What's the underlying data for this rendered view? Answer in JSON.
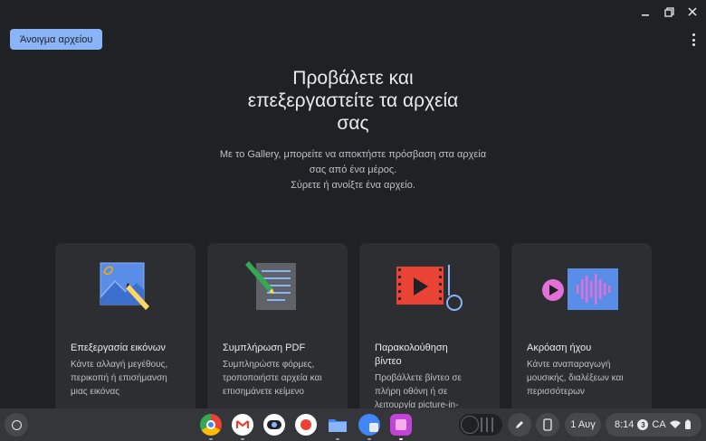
{
  "toolbar": {
    "open_label": "Άνοιγμα αρχείου"
  },
  "hero": {
    "title_line1": "Προβάλετε και",
    "title_line2": "επεξεργαστείτε τα αρχεία",
    "title_line3": "σας",
    "sub_line1": "Με το Gallery, μπορείτε να αποκτήστε πρόσβαση στα αρχεία",
    "sub_line2": "σας από ένα μέρος.",
    "sub_line3": "Σύρετε ή ανοίξτε ένα αρχείο."
  },
  "cards": [
    {
      "icon": "image-edit-icon",
      "title": "Επεξεργασία εικόνων",
      "desc_lines": [
        "Κάντε αλλαγή μεγέθους,",
        "περικοπή ή επισήμανση",
        "μιας εικόνας"
      ]
    },
    {
      "icon": "pdf-fill-icon",
      "title": "Συμπλήρωση PDF",
      "desc_lines": [
        "Συμπληρώστε φόρμες,",
        "τροποποιήστε αρχεία και",
        "επισημάνετε κείμενο"
      ]
    },
    {
      "icon": "video-play-icon",
      "title_lines": [
        "Παρακολούθηση",
        "βίντεο"
      ],
      "desc_lines": [
        "Προβάλλετε βίντεο σε",
        "πλήρη οθόνη ή σε",
        "λειτουργία picture-in-"
      ]
    },
    {
      "icon": "audio-play-icon",
      "title": "Ακρόαση ήχου",
      "desc_lines": [
        "Κάντε αναπαραγωγή",
        "μουσικής, διαλέξεων και",
        "περισσότερων"
      ]
    }
  ],
  "shelf": {
    "apps": [
      "chrome-icon",
      "gmail-icon",
      "camera-app-icon",
      "podcast-app-icon",
      "files-app-icon",
      "translate-app-icon",
      "gallery-app-icon"
    ],
    "date": "1 Αυγ",
    "time": "8:14",
    "notification_count": "3",
    "locale": "CA"
  },
  "colors": {
    "accent": "#8ab4f8",
    "background": "#202124",
    "card": "#2d2e31",
    "shelf": "#35363a"
  }
}
